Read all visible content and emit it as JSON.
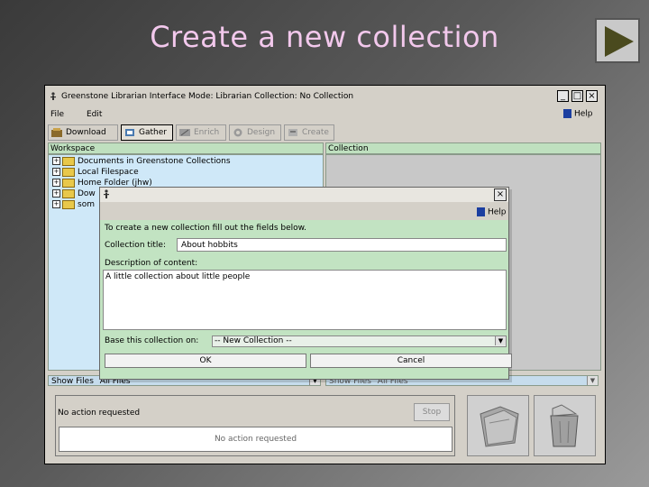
{
  "slide": {
    "title": "Create a new collection",
    "next_button_icon": "play-triangle-icon"
  },
  "window": {
    "title": "Greenstone Librarian Interface  Mode: Librarian  Collection: No Collection",
    "menu": [
      "File",
      "Edit"
    ],
    "help_label": "Help"
  },
  "tabs": [
    {
      "label": "Download",
      "icon": "download-icon"
    },
    {
      "label": "Gather",
      "icon": "gather-icon"
    },
    {
      "label": "Enrich",
      "icon": "enrich-icon"
    },
    {
      "label": "Design",
      "icon": "design-icon"
    },
    {
      "label": "Create",
      "icon": "create-icon"
    }
  ],
  "workspace": {
    "header": "Workspace",
    "items": [
      "Documents in Greenstone Collections",
      "Local Filespace",
      "Home Folder (jhw)",
      "Dow",
      "som"
    ],
    "show_files_label": "Show Files",
    "show_files_value": "All Files"
  },
  "collection": {
    "header": "Collection",
    "show_files_label": "Show Files",
    "show_files_value": "All Files"
  },
  "status": {
    "action_label": "No action requested",
    "stop_label": "Stop",
    "progress_label": "No action requested"
  },
  "dialog": {
    "help_label": "Help",
    "instructions": "To create a new collection fill out the fields below.",
    "title_label": "Collection title:",
    "title_value": "About hobbits",
    "description_label": "Description of content:",
    "description_value": "A little collection about little people",
    "base_label": "Base this collection on:",
    "base_value": "-- New Collection --",
    "ok_label": "OK",
    "cancel_label": "Cancel"
  },
  "colors": {
    "title_text": "#f2c8ec",
    "workspace_bg": "#cfe8f8",
    "dialog_body_bg": "#c2e3c2",
    "header_bg": "#bfe0bf"
  }
}
